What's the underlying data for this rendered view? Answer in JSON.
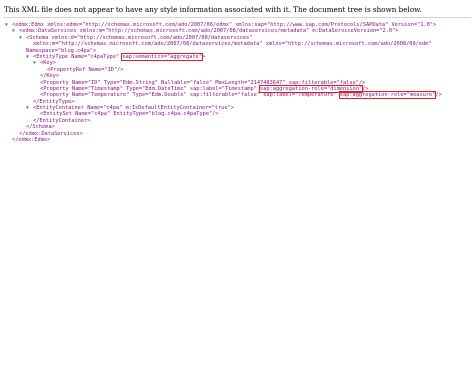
{
  "notice": "This XML file does not appear to have any style information associated with it. The document tree is shown below.",
  "tree": {
    "l1": {
      "tri": "▼",
      "text": "<edmx:Edmx xmlns:edmx=\"http://schemas.microsoft.com/ado/2007/06/edmx\" xmlns:sap=\"http://www.sap.com/Protocols/SAPData\" Version=\"1.0\">"
    },
    "l2": {
      "tri": "▼",
      "text": "<edmx:DataServices xmlns:m=\"http://schemas.microsoft.com/ado/2007/08/dataservices/metadata\" m:DataServiceVersion=\"2.0\">"
    },
    "l3": {
      "tri": "▼",
      "text": "<Schema xmlns:d=\"http://schemas.microsoft.com/ado/2007/08/dataservices\""
    },
    "l3b": {
      "text": "xmlns:m=\"http://schemas.microsoft.com/ado/2007/08/dataservices/metadata\" xmlns=\"http://schemas.microsoft.com/ado/2008/09/edm\""
    },
    "l3c": {
      "text": "Namespace=\"blog.c4pa\">"
    },
    "l4": {
      "tri": "▼",
      "pre": "<EntityType Name=\"c4paType\" ",
      "mark": "sap:semantics=\"aggregate\"",
      "post": ">"
    },
    "l5": {
      "tri": "▼",
      "text": "<Key>"
    },
    "l6": {
      "text": "<PropertyRef Name=\"ID\"/>"
    },
    "l7": {
      "text": "</Key>"
    },
    "l8": {
      "text": "<Property Name=\"ID\" Type=\"Edm.String\" Nullable=\"false\" MaxLength=\"2147483647\" sap:filterable=\"false\"/>"
    },
    "l9": {
      "pre": "<Property Name=\"Timestamp\" Type=\"Edm.DateTime\" sap:label=\"Timestamp\" ",
      "mark": "sap:aggregation-role=\"dimension\"",
      "post": "/>"
    },
    "l10": {
      "pre": "<Property Name=\"Temperature\" Type=\"Edm.Double\" sap:filterable=\"false\" sap:label=\"Temperature\" ",
      "mark": "sap:aggregation-role=\"measure\"",
      "post": "/>"
    },
    "l11": {
      "text": "</EntityType>"
    },
    "l12": {
      "tri": "▼",
      "text": "<EntityContainer Name=\"c4pa\" m:IsDefaultEntityContainer=\"true\">"
    },
    "l13": {
      "text": "<EntitySet Name=\"c4pa\" EntityType=\"blog.c4pa.c4paType\"/>"
    },
    "l14": {
      "text": "</EntityContainer>"
    },
    "l15": {
      "text": "</Schema>"
    },
    "l16": {
      "text": "</edmx:DataServices>"
    },
    "l17": {
      "text": "</edmx:Edmx>"
    }
  },
  "colors": {
    "tag": "#881280",
    "highlight_border": "#e02020",
    "triangle": "#6e6e6e"
  }
}
